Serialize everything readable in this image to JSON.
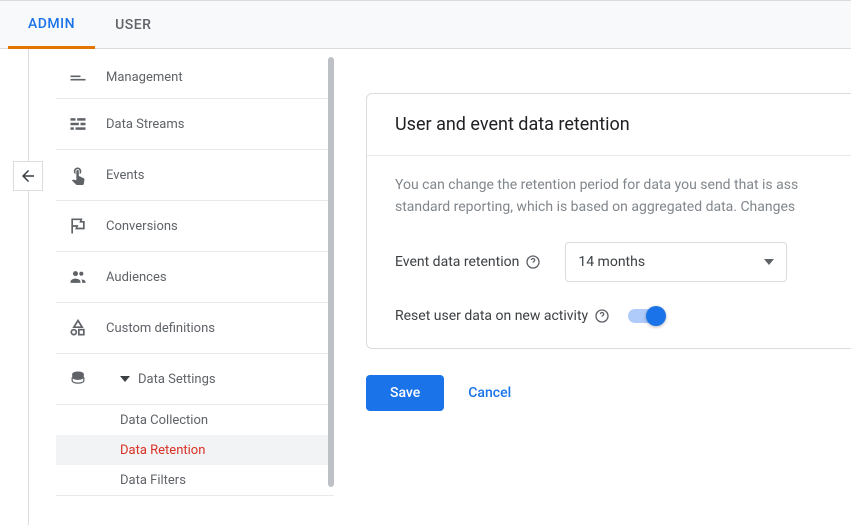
{
  "tabs": {
    "admin": "ADMIN",
    "user": "USER"
  },
  "sidebar": {
    "management": "Management",
    "data_streams": "Data Streams",
    "events": "Events",
    "conversions": "Conversions",
    "audiences": "Audiences",
    "custom_definitions": "Custom definitions",
    "data_settings": "Data Settings",
    "sub": {
      "data_collection": "Data Collection",
      "data_retention": "Data Retention",
      "data_filters": "Data Filters"
    }
  },
  "card": {
    "title": "User and event data retention",
    "desc1": "You can change the retention period for data you send that is ass",
    "desc2": "standard reporting, which is based on aggregated data. Changes ",
    "event_label": "Event data retention",
    "event_value": "14 months",
    "reset_label": "Reset user data on new activity"
  },
  "actions": {
    "save": "Save",
    "cancel": "Cancel"
  }
}
